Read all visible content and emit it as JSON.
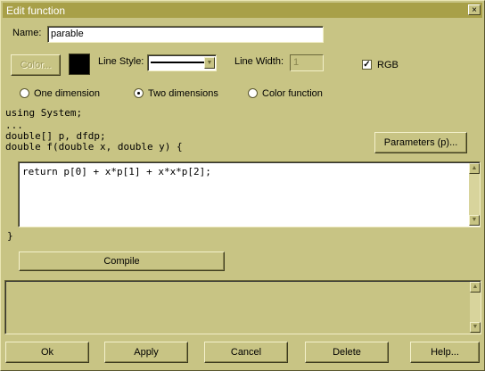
{
  "window": {
    "title": "Edit function",
    "close_glyph": "×"
  },
  "name": {
    "label": "Name:",
    "value": "parable"
  },
  "color_button": {
    "label": "Color...",
    "swatch": "#000000"
  },
  "line_style": {
    "label": "Line Style:"
  },
  "line_width": {
    "label": "Line Width:",
    "value": "1"
  },
  "rgb": {
    "label": "RGB",
    "checked": true,
    "glyph": "✓"
  },
  "dimension_options": [
    {
      "label": "One dimension",
      "selected": false
    },
    {
      "label": "Two dimensions",
      "selected": true
    },
    {
      "label": "Color function",
      "selected": false
    }
  ],
  "code": {
    "line1": "using System;",
    "line2": "...",
    "line3": "double[] p, dfdp;",
    "line4": "double f(double x, double y) {",
    "body": "return p[0] + x*p[1] + x*x*p[2];",
    "closing": "}"
  },
  "parameters_button": "Parameters (p)...",
  "compile_button": "Compile",
  "bottom_buttons": {
    "ok": "Ok",
    "apply": "Apply",
    "cancel": "Cancel",
    "delete": "Delete",
    "help": "Help..."
  }
}
